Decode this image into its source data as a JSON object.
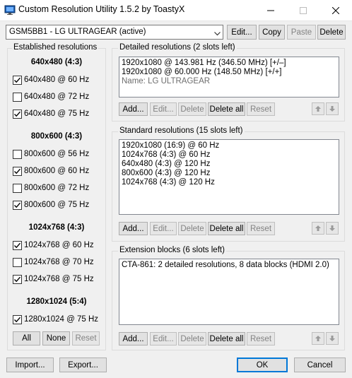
{
  "window": {
    "title": "Custom Resolution Utility 1.5.2 by ToastyX"
  },
  "monitor": {
    "selected": "GSM5BB1 - LG ULTRAGEAR (active)",
    "edit_label": "Edit...",
    "copy_label": "Copy",
    "paste_label": "Paste",
    "delete_label": "Delete"
  },
  "established": {
    "title": "Established resolutions",
    "groups": [
      {
        "header": "640x480 (4:3)",
        "items": [
          {
            "label": "640x480 @ 60 Hz",
            "checked": true
          },
          {
            "label": "640x480 @ 72 Hz",
            "checked": false
          },
          {
            "label": "640x480 @ 75 Hz",
            "checked": true
          }
        ]
      },
      {
        "header": "800x600 (4:3)",
        "items": [
          {
            "label": "800x600 @ 56 Hz",
            "checked": false
          },
          {
            "label": "800x600 @ 60 Hz",
            "checked": true
          },
          {
            "label": "800x600 @ 72 Hz",
            "checked": false
          },
          {
            "label": "800x600 @ 75 Hz",
            "checked": true
          }
        ]
      },
      {
        "header": "1024x768 (4:3)",
        "items": [
          {
            "label": "1024x768 @ 60 Hz",
            "checked": true
          },
          {
            "label": "1024x768 @ 70 Hz",
            "checked": false
          },
          {
            "label": "1024x768 @ 75 Hz",
            "checked": true
          }
        ]
      },
      {
        "header": "1280x1024 (5:4)",
        "items": [
          {
            "label": "1280x1024 @ 75 Hz",
            "checked": true
          }
        ]
      }
    ],
    "all_label": "All",
    "none_label": "None",
    "reset_label": "Reset"
  },
  "detailed": {
    "title": "Detailed resolutions (2 slots left)",
    "lines": [
      "1920x1080 @ 143.981 Hz (346.50 MHz) [+/–]",
      "1920x1080 @ 60.000 Hz (148.50 MHz) [+/+]"
    ],
    "name_line": "Name: LG ULTRAGEAR"
  },
  "standard": {
    "title": "Standard resolutions (15 slots left)",
    "lines": [
      "1920x1080 (16:9) @ 60 Hz",
      "1024x768 (4:3) @ 60 Hz",
      "640x480 (4:3) @ 120 Hz",
      "800x600 (4:3) @ 120 Hz",
      "1024x768 (4:3) @ 120 Hz"
    ]
  },
  "extension": {
    "title": "Extension blocks (6 slots left)",
    "lines": [
      "CTA-861: 2 detailed resolutions, 8 data blocks (HDMI 2.0)"
    ]
  },
  "list_buttons": {
    "add": "Add...",
    "edit": "Edit...",
    "delete": "Delete",
    "delete_all": "Delete all",
    "reset": "Reset"
  },
  "footer": {
    "import_label": "Import...",
    "export_label": "Export...",
    "ok_label": "OK",
    "cancel_label": "Cancel"
  },
  "icons": {
    "app": "monitor-icon",
    "minimize": "minimize-icon",
    "maximize": "maximize-icon",
    "close": "close-icon",
    "move_up": "arrow-up-icon",
    "move_down": "arrow-down-icon"
  }
}
